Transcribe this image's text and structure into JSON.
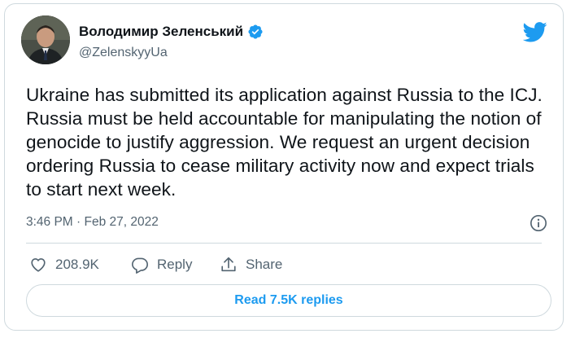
{
  "author": {
    "name": "Володимир Зеленський",
    "handle": "@ZelenskyyUa",
    "verified": true,
    "avatar": "profile-photo"
  },
  "tweet": {
    "text": "Ukraine has submitted its application against Russia to the ICJ. Russia must be held accountable for manipulating the notion of genocide to justify aggression. We request an urgent decision ordering Russia to cease military activity now and expect trials to start next week.",
    "timestamp": "3:46 PM · Feb 27, 2022"
  },
  "actions": {
    "like_count": "208.9K",
    "reply_label": "Reply",
    "share_label": "Share"
  },
  "read_replies_label": "Read 7.5K replies",
  "colors": {
    "accent": "#1d9bf0",
    "text": "#0f1419",
    "muted": "#536471",
    "border": "#cfd9de"
  },
  "icons": [
    "verified-badge-icon",
    "twitter-bird-icon",
    "info-icon",
    "heart-icon",
    "reply-icon",
    "share-icon"
  ]
}
